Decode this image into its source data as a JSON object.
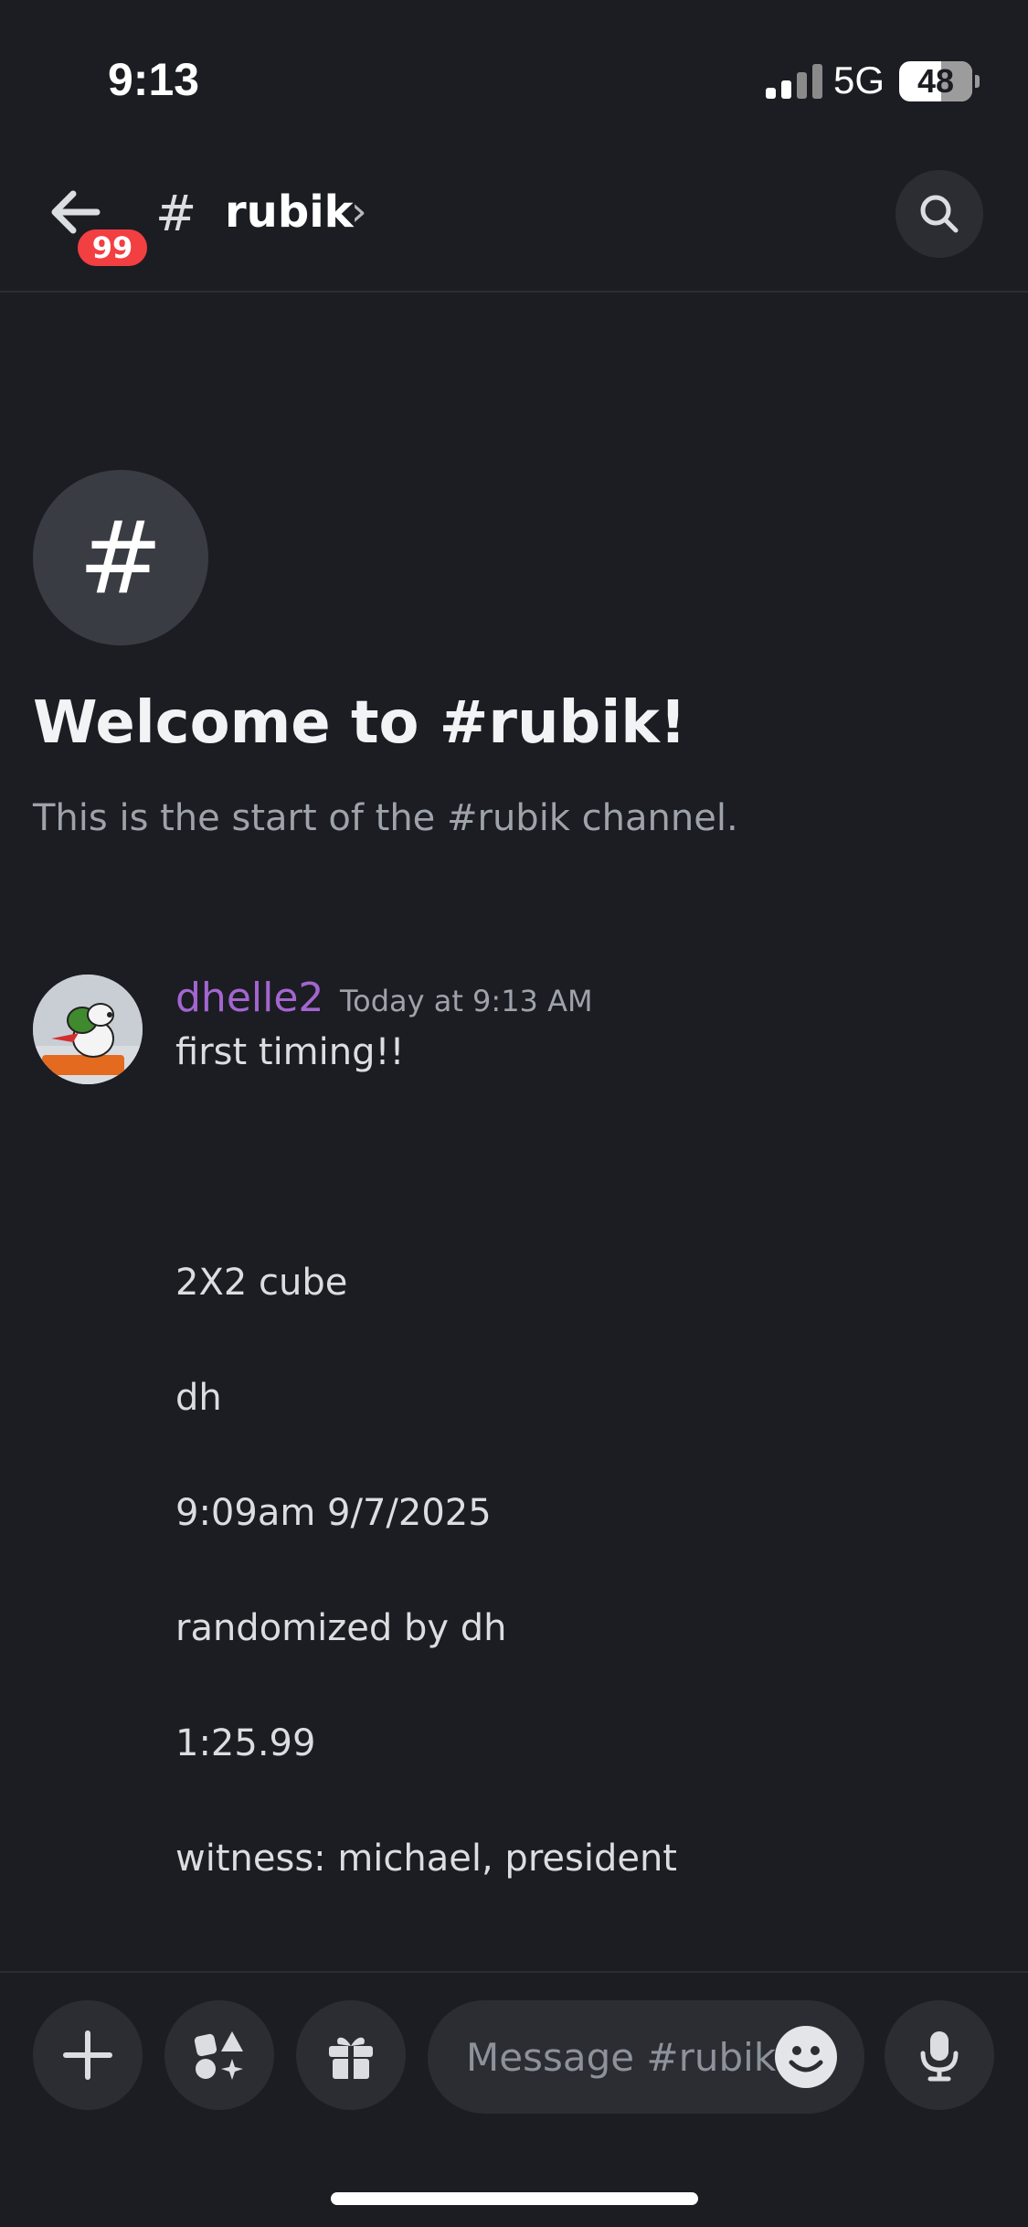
{
  "status_bar": {
    "time": "9:13",
    "network": "5G",
    "battery": "48",
    "signal_icon": "cellular-signal-icon"
  },
  "header": {
    "back_icon": "back-arrow-icon",
    "unread_count": "99",
    "channel_hash": "#",
    "channel_name": "rubik",
    "chevron": "›",
    "search_icon": "search-icon"
  },
  "welcome": {
    "icon_glyph": "#",
    "title": "Welcome to #rubik!",
    "subtitle": "This is the start of the #rubik channel."
  },
  "message": {
    "username": "dhelle2",
    "username_color": "#a366d0",
    "timestamp": "Today at 9:13 AM",
    "lines": [
      "first timing!!",
      "2X2 cube",
      "dh",
      "9:09am 9/7/2025",
      "randomized by dh",
      "1:25.99",
      "witness: michael, president"
    ]
  },
  "composer": {
    "placeholder": "Message #rubik",
    "add_icon": "plus-icon",
    "apps_icon": "apps-icon",
    "gift_icon": "gift-icon",
    "emoji_icon": "emoji-icon",
    "mic_icon": "microphone-icon"
  },
  "colors": {
    "background": "#1c1d22",
    "surface": "#2b2d33",
    "badge": "#f23f42"
  }
}
